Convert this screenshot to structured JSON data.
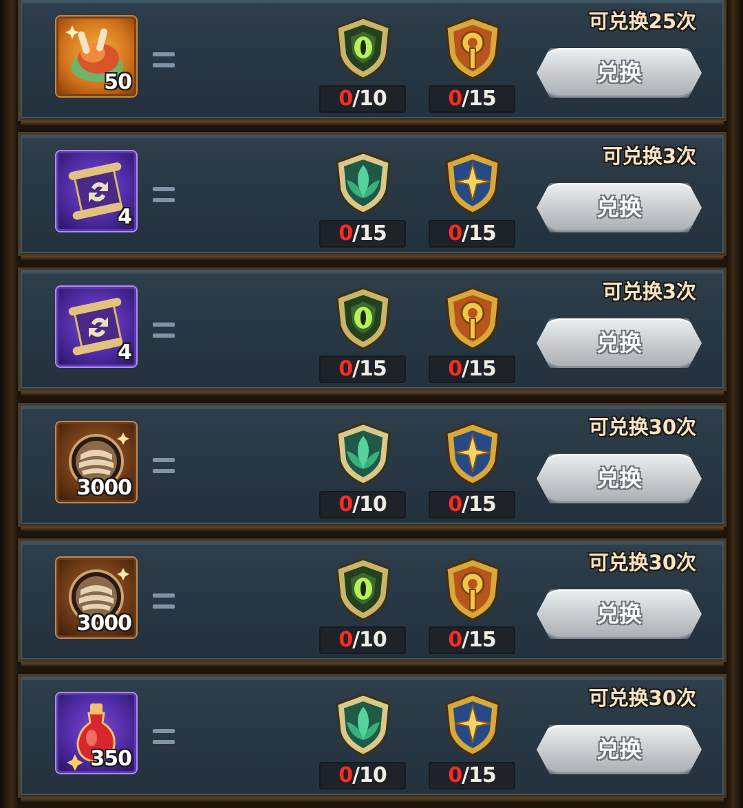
{
  "rows": [
    {
      "item": {
        "name": "meat-dish",
        "frame": "orange",
        "quantity": "50"
      },
      "costs": [
        {
          "icon": "green-eye-emblem",
          "have": "0",
          "need": "/10"
        },
        {
          "icon": "gold-sword-emblem",
          "have": "0",
          "need": "/15"
        }
      ],
      "limit": "可兑换25次",
      "button": "兑换"
    },
    {
      "item": {
        "name": "purple-scroll",
        "frame": "purple",
        "quantity": "4"
      },
      "costs": [
        {
          "icon": "green-leaf-emblem",
          "have": "0",
          "need": "/15"
        },
        {
          "icon": "blue-star-emblem",
          "have": "0",
          "need": "/15"
        }
      ],
      "limit": "可兑换3次",
      "button": "兑换"
    },
    {
      "item": {
        "name": "purple-scroll",
        "frame": "purple",
        "quantity": "4"
      },
      "costs": [
        {
          "icon": "green-eye-emblem",
          "have": "0",
          "need": "/15"
        },
        {
          "icon": "gold-sword-emblem",
          "have": "0",
          "need": "/15"
        }
      ],
      "limit": "可兑换3次",
      "button": "兑换"
    },
    {
      "item": {
        "name": "bronze-medallion",
        "frame": "bronze",
        "quantity": "3000"
      },
      "costs": [
        {
          "icon": "green-leaf-emblem",
          "have": "0",
          "need": "/10"
        },
        {
          "icon": "blue-star-emblem",
          "have": "0",
          "need": "/15"
        }
      ],
      "limit": "可兑换30次",
      "button": "兑换"
    },
    {
      "item": {
        "name": "bronze-medallion",
        "frame": "bronze",
        "quantity": "3000"
      },
      "costs": [
        {
          "icon": "green-eye-emblem",
          "have": "0",
          "need": "/10"
        },
        {
          "icon": "gold-sword-emblem",
          "have": "0",
          "need": "/15"
        }
      ],
      "limit": "可兑换30次",
      "button": "兑换"
    },
    {
      "item": {
        "name": "red-potion",
        "frame": "purple",
        "quantity": "350"
      },
      "costs": [
        {
          "icon": "green-leaf-emblem",
          "have": "0",
          "need": "/10"
        },
        {
          "icon": "blue-star-emblem",
          "have": "0",
          "need": "/15"
        }
      ],
      "limit": "可兑换30次",
      "button": "兑换"
    }
  ]
}
